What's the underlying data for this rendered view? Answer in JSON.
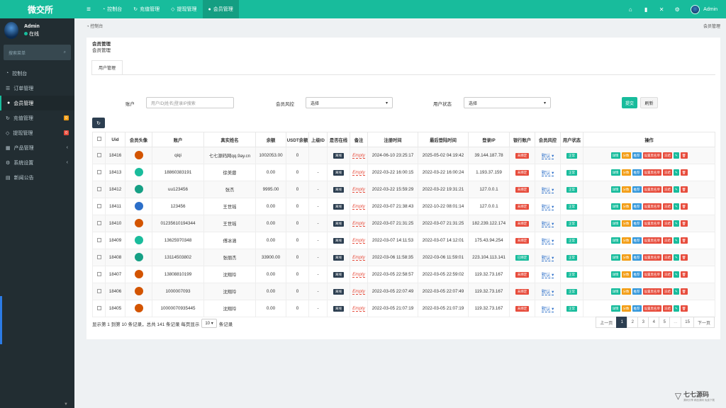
{
  "brand": "微交所",
  "topnav": {
    "items": [
      {
        "label": "控制台"
      },
      {
        "label": "充值管理"
      },
      {
        "label": "提现管理"
      },
      {
        "label": "会员管理"
      }
    ],
    "user": "Admin"
  },
  "sidebar": {
    "user_name": "Admin",
    "status": "在线",
    "search_placeholder": "搜索菜单",
    "items": [
      {
        "label": "控制台"
      },
      {
        "label": "订单管理"
      },
      {
        "label": "会员管理"
      },
      {
        "label": "充值管理",
        "badge": "0"
      },
      {
        "label": "提现管理",
        "badge": "0"
      },
      {
        "label": "产品管理"
      },
      {
        "label": "系统设置"
      },
      {
        "label": "新闻公告"
      }
    ]
  },
  "breadcrumb": {
    "home": "控制台",
    "current": "会员管理"
  },
  "panel": {
    "title": "会员管理",
    "subtitle": "会员管理",
    "tab": "用户管理"
  },
  "filters": {
    "account_label": "账户",
    "account_placeholder": "用户ID|姓名|登录IP搜索",
    "risk_label": "会员风控",
    "risk_value": "选择",
    "status_label": "用户状态",
    "status_value": "选择",
    "submit": "提交",
    "reset": "刷新"
  },
  "table": {
    "headers": [
      "Uid",
      "会员头像",
      "账户",
      "真实姓名",
      "余额",
      "USDT余额",
      "上级ID",
      "是否在线",
      "备注",
      "注册时间",
      "最后登陆时间",
      "登录IP",
      "银行账户",
      "会员风控",
      "用户状态",
      "操作"
    ],
    "rows": [
      {
        "uid": "18416",
        "account": "qiqi",
        "name": "七七源码网qq.9ay.cn",
        "balance": "1002053.00",
        "usdt": "0",
        "parent": "",
        "online": "离线",
        "note": "Empty",
        "reg": "2024-06-10 23:25:17",
        "last": "2025-05-02 04:19:42",
        "ip": "39.144.187.78",
        "bank": "未绑定",
        "risk": "默认",
        "status": "正常"
      },
      {
        "uid": "18413",
        "account": "18860383191",
        "name": "徐美蓉",
        "balance": "0.00",
        "usdt": "0",
        "parent": "-",
        "online": "离线",
        "note": "Empty",
        "reg": "2022-03-22 16:00:15",
        "last": "2022-03-22 16:00:24",
        "ip": "1.193.37.159",
        "bank": "未绑定",
        "risk": "默认",
        "status": "正常"
      },
      {
        "uid": "18412",
        "account": "uu123456",
        "name": "张杰",
        "balance": "9995.00",
        "usdt": "0",
        "parent": "-",
        "online": "离线",
        "note": "Empty",
        "reg": "2022-03-22 15:59:29",
        "last": "2022-03-22 19:31:21",
        "ip": "127.0.0.1",
        "bank": "未绑定",
        "risk": "默认",
        "status": "正常"
      },
      {
        "uid": "18411",
        "account": "123456",
        "name": "王世瑶",
        "balance": "0.00",
        "usdt": "0",
        "parent": "-",
        "online": "离线",
        "note": "Empty",
        "reg": "2022-03-07 21:38:43",
        "last": "2022-10-22 08:01:14",
        "ip": "127.0.0.1",
        "bank": "未绑定",
        "risk": "默认",
        "status": "正常"
      },
      {
        "uid": "18410",
        "account": "01235610194344",
        "name": "王世瑶",
        "balance": "0.00",
        "usdt": "0",
        "parent": "-",
        "online": "离线",
        "note": "Empty",
        "reg": "2022-03-07 21:31:25",
        "last": "2022-03-07 21:31:25",
        "ip": "182.239.122.174",
        "bank": "未绑定",
        "risk": "默认",
        "status": "正常"
      },
      {
        "uid": "18409",
        "account": "13625970348",
        "name": "傅冰涵",
        "balance": "0.00",
        "usdt": "0",
        "parent": "-",
        "online": "离线",
        "note": "Empty",
        "reg": "2022-03-07 14:11:53",
        "last": "2022-03-07 14:12:01",
        "ip": "175.43.94.254",
        "bank": "未绑定",
        "risk": "默认",
        "status": "正常"
      },
      {
        "uid": "18408",
        "account": "13114503802",
        "name": "张丽杰",
        "balance": "33900.00",
        "usdt": "0",
        "parent": "-",
        "online": "离线",
        "note": "Empty",
        "reg": "2022-03-06 11:58:35",
        "last": "2022-03-06 11:59:01",
        "ip": "223.104.113.141",
        "bank": "已绑定",
        "risk": "默认",
        "status": "正常"
      },
      {
        "uid": "18407",
        "account": "13808810199",
        "name": "沈翔玲",
        "balance": "0.00",
        "usdt": "0",
        "parent": "-",
        "online": "离线",
        "note": "Empty",
        "reg": "2022-03-05 22:58:57",
        "last": "2022-03-05 22:59:02",
        "ip": "119.32.73.167",
        "bank": "未绑定",
        "risk": "默认",
        "status": "正常"
      },
      {
        "uid": "18406",
        "account": "1000007093",
        "name": "沈翔玲",
        "balance": "0.00",
        "usdt": "0",
        "parent": "-",
        "online": "离线",
        "note": "Empty",
        "reg": "2022-03-05 22:07:49",
        "last": "2022-03-05 22:07:49",
        "ip": "119.32.73.167",
        "bank": "未绑定",
        "risk": "默认",
        "status": "正常"
      },
      {
        "uid": "18405",
        "account": "10000070935445",
        "name": "沈翔玲",
        "balance": "0.00",
        "usdt": "0",
        "parent": "-",
        "online": "离线",
        "note": "Empty",
        "reg": "2022-03-05 21:07:19",
        "last": "2022-03-05 21:07:19",
        "ip": "119.32.73.167",
        "bank": "未绑定",
        "risk": "默认",
        "status": "正常"
      }
    ],
    "ops": [
      "详情",
      "分数",
      "推荐",
      "设置黑名单",
      "冻结"
    ]
  },
  "pagination": {
    "info_prefix": "显示第 1 到第 10 条记录，总共 141 条记录 每页显示",
    "per_page": "10",
    "info_suffix": "条记录",
    "prev": "上一页",
    "pages": [
      "1",
      "2",
      "3",
      "4",
      "5",
      "...",
      "15"
    ],
    "next": "下一页"
  },
  "watermark": {
    "title": "七七源码",
    "sub": "源码分享 精品源码 免费下载"
  },
  "colors": {
    "primary": "#18bc9c",
    "dark": "#2c3e50",
    "sidebar": "#222d32",
    "danger": "#e74c3c",
    "warning": "#f39c12",
    "info": "#3498db"
  }
}
